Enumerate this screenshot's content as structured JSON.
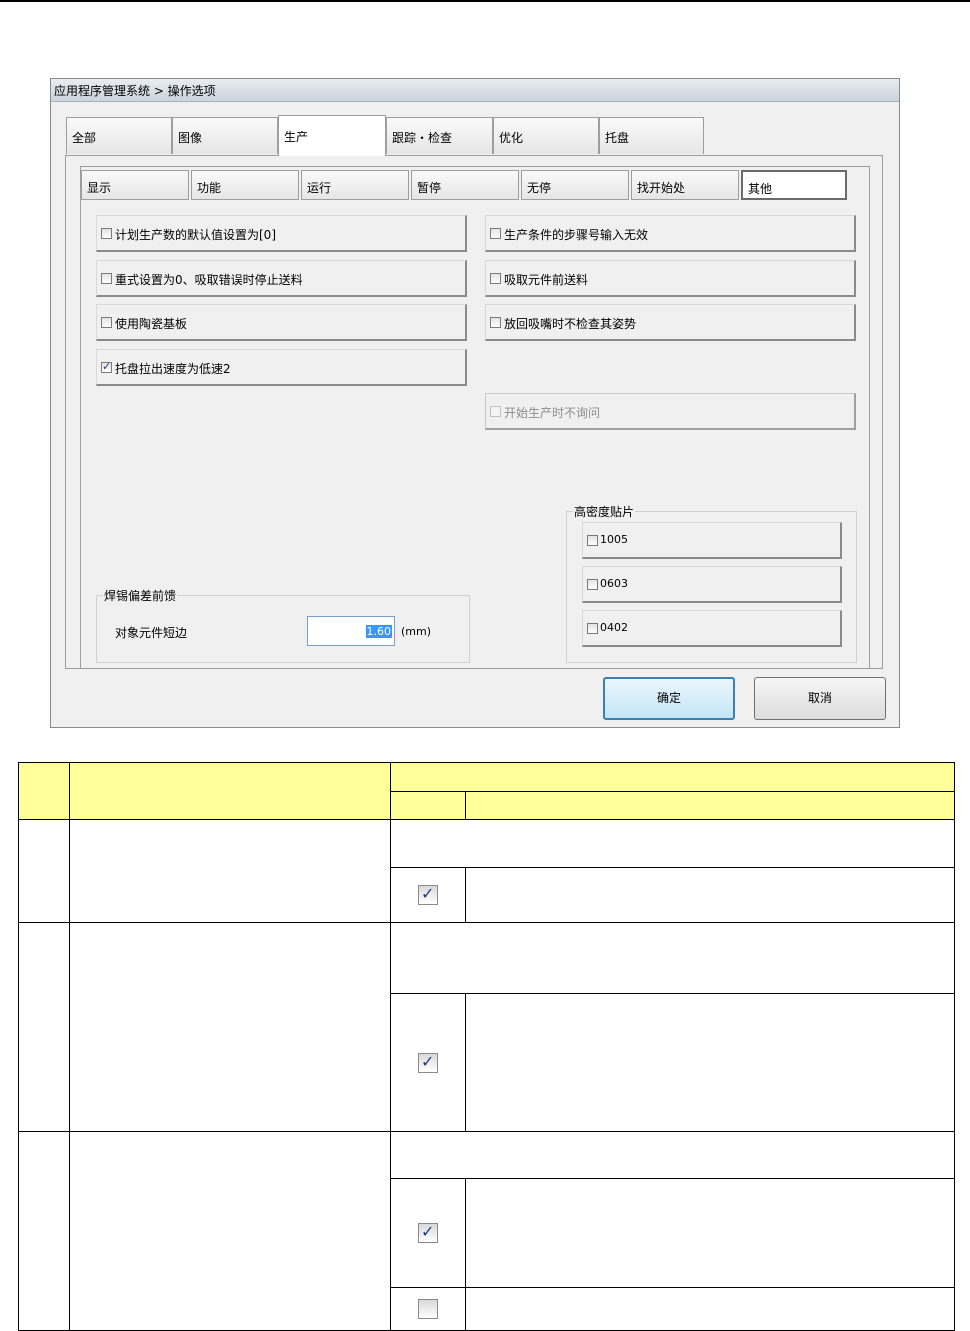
{
  "dialog": {
    "title": "应用程序管理系统 > 操作选项",
    "main_tabs": [
      "全部",
      "图像",
      "生产",
      "跟踪・检查",
      "优化",
      "托盘"
    ],
    "active_main_tab": "生产",
    "sub_tabs": [
      "显示",
      "功能",
      "运行",
      "暂停",
      "无停",
      "找开始处",
      "其他"
    ],
    "active_sub_tab": "其他",
    "left_options": [
      {
        "label": "计划生产数的默认值设置为[0]",
        "checked": false
      },
      {
        "label": "重式设置为0、吸取错误时停止送料",
        "checked": false
      },
      {
        "label": "使用陶瓷基板",
        "checked": false
      },
      {
        "label": "托盘拉出速度为低速2",
        "checked": true
      }
    ],
    "right_options": [
      {
        "label": "生产条件的步骤号输入无效",
        "checked": false
      },
      {
        "label": "吸取元件前送料",
        "checked": false
      },
      {
        "label": "放回吸嘴时不检查其姿势",
        "checked": false
      },
      {
        "label": "开始生产时不询问",
        "checked": false,
        "disabled": true
      }
    ],
    "solder_group": {
      "title": "焊锡偏差前馈",
      "field_label": "对象元件短边",
      "value": "1.60",
      "unit": "(mm)"
    },
    "hd_group": {
      "title": "高密度贴片",
      "options": [
        {
          "label": "1005",
          "checked": false
        },
        {
          "label": "0603",
          "checked": false
        },
        {
          "label": "0402",
          "checked": false
        }
      ]
    },
    "ok_label": "确定",
    "cancel_label": "取消"
  },
  "table": {
    "checkbox_states": [
      true,
      true,
      true,
      false
    ]
  }
}
